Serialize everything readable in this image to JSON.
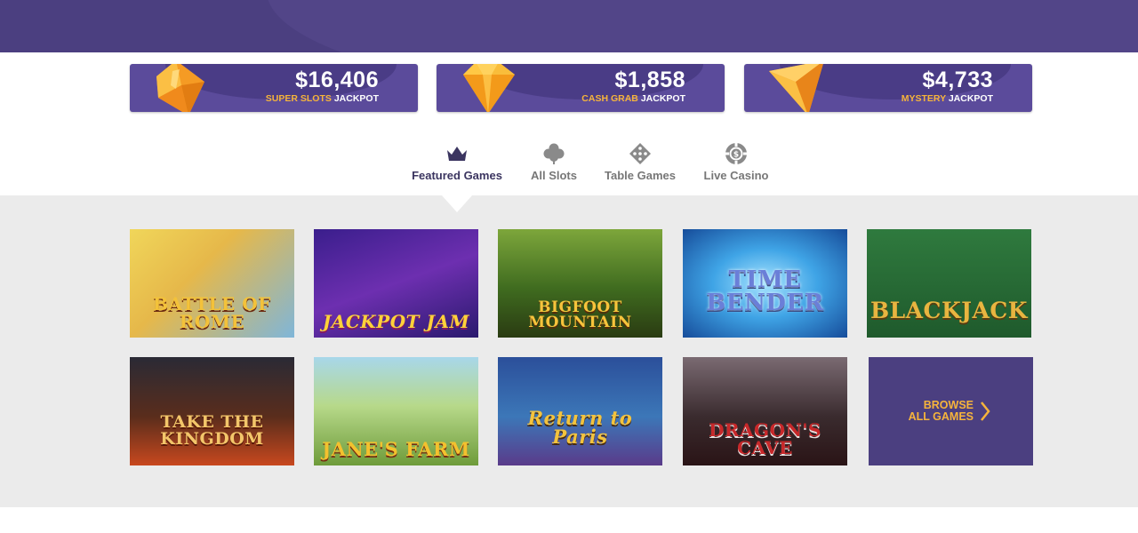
{
  "jackpots": [
    {
      "amount": "$16,406",
      "highlight": "SUPER SLOTS",
      "suffix": "JACKPOT",
      "icon": "orange-gem-icon"
    },
    {
      "amount": "$1,858",
      "highlight": "CASH GRAB",
      "suffix": "JACKPOT",
      "icon": "yellow-diamond-icon"
    },
    {
      "amount": "$4,733",
      "highlight": "MYSTERY",
      "suffix": "JACKPOT",
      "icon": "orange-triangle-gem-icon"
    }
  ],
  "tabs": [
    {
      "label": "Featured Games",
      "icon": "crown-icon",
      "active": true
    },
    {
      "label": "All Slots",
      "icon": "clover-icon",
      "active": false
    },
    {
      "label": "Table Games",
      "icon": "dice-icon",
      "active": false
    },
    {
      "label": "Live Casino",
      "icon": "poker-chip-icon",
      "active": false
    }
  ],
  "games": [
    {
      "title": "BATTLE OF ROME"
    },
    {
      "title": "JACKPOT JAM"
    },
    {
      "title": "BIGFOOT MOUNTAIN"
    },
    {
      "title": "TIME BENDER"
    },
    {
      "title": "BLACKJACK"
    },
    {
      "title": "TAKE THE KINGDOM"
    },
    {
      "title": "JANE'S FARM"
    },
    {
      "title": "Return to Paris"
    },
    {
      "title": "DRAGON'S CAVE"
    }
  ],
  "browse": {
    "line1": "BROWSE",
    "line2": "ALL GAMES"
  },
  "colors": {
    "brand_purple": "#4b3f80",
    "accent_gold": "#f6b43b"
  }
}
